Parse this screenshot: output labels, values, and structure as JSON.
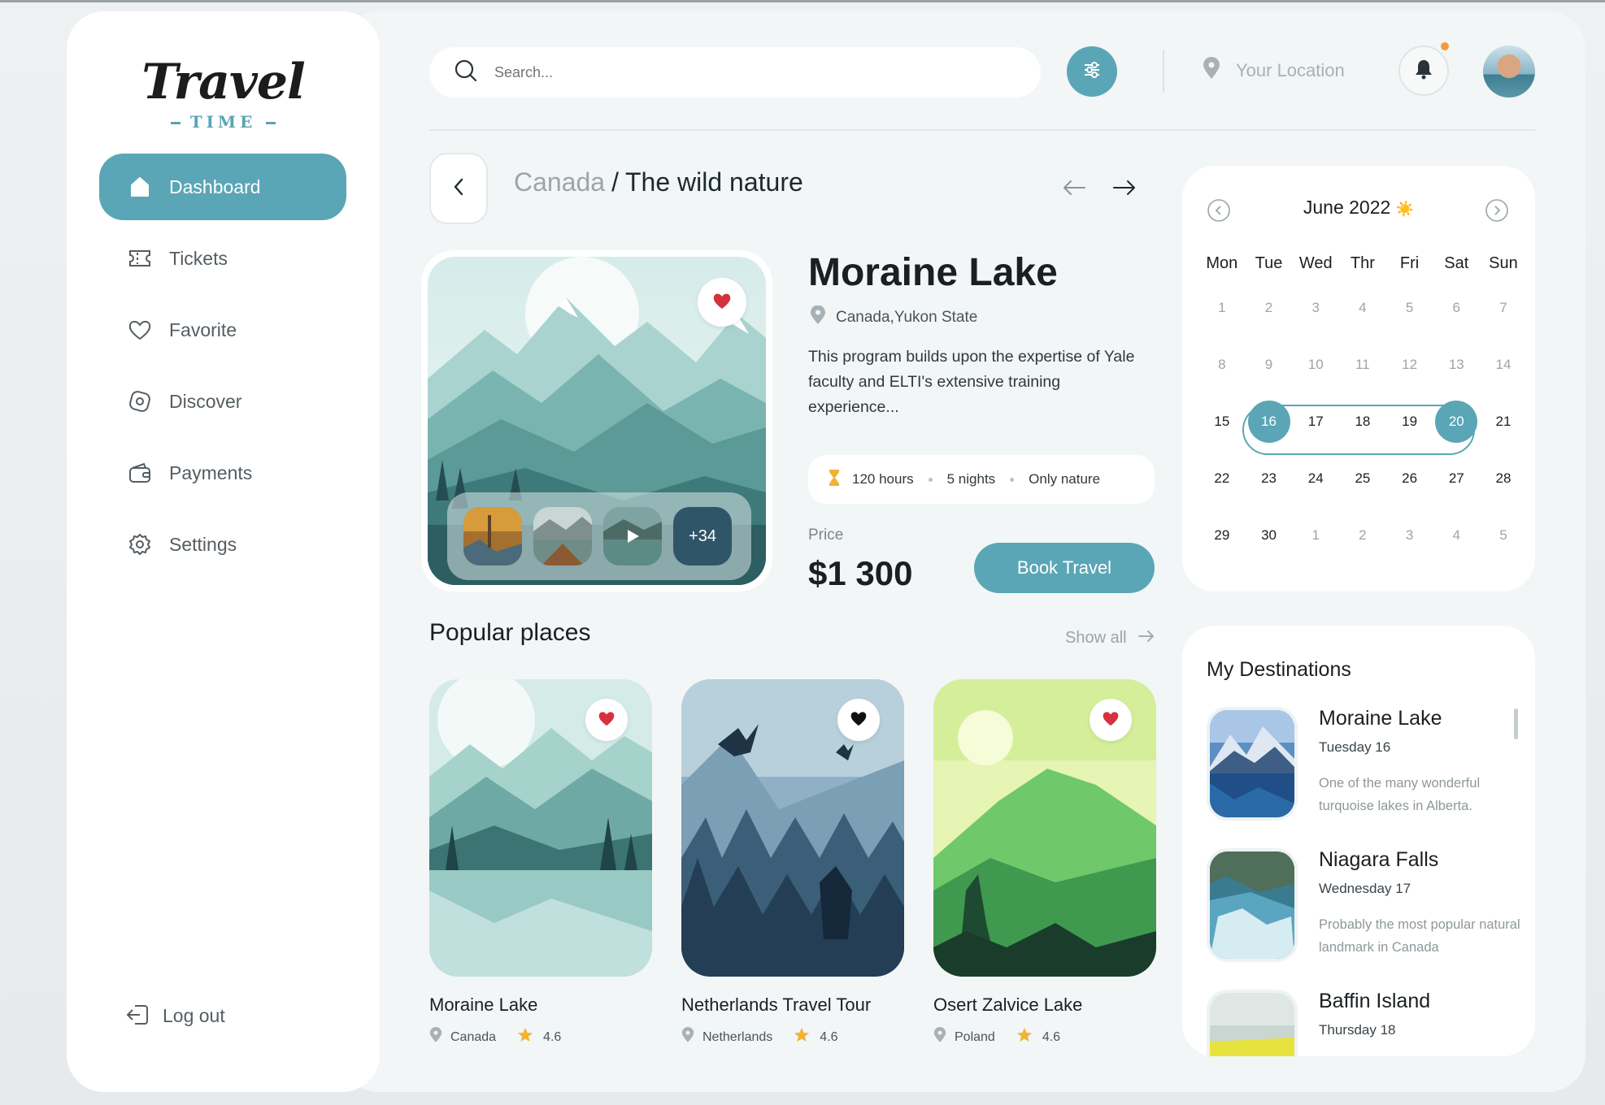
{
  "app": {
    "logo_main": "Travel",
    "logo_sub": "TIME"
  },
  "sidebar": {
    "items": [
      {
        "label": "Dashboard",
        "icon": "home-icon",
        "active": true
      },
      {
        "label": "Tickets",
        "icon": "ticket-icon",
        "active": false
      },
      {
        "label": "Favorite",
        "icon": "heart-icon",
        "active": false
      },
      {
        "label": "Discover",
        "icon": "compass-icon",
        "active": false
      },
      {
        "label": "Payments",
        "icon": "wallet-icon",
        "active": false
      },
      {
        "label": "Settings",
        "icon": "gear-icon",
        "active": false
      }
    ],
    "logout_label": "Log out"
  },
  "header": {
    "search_placeholder": "Search...",
    "location_placeholder": "Your Location",
    "has_notification": true
  },
  "breadcrumb": {
    "parent": "Canada",
    "separator": "/",
    "current": "The wild nature"
  },
  "featured": {
    "title": "Moraine Lake",
    "location": "Canada,Yukon State",
    "description": "This program builds upon the expertise of Yale faculty and ELTI's extensive training experience...",
    "meta": [
      "120 hours",
      "5 nights",
      "Only nature"
    ],
    "price_label": "Price",
    "price": "$1 300",
    "book_label": "Book Travel",
    "more_photos": "+34",
    "favorited": true
  },
  "calendar": {
    "title": "June 2022",
    "title_emoji": "☀️",
    "weekdays": [
      "Mon",
      "Tue",
      "Wed",
      "Thr",
      "Fri",
      "Sat",
      "Sun"
    ],
    "weeks": [
      [
        "1",
        "2",
        "3",
        "4",
        "5",
        "6",
        "7"
      ],
      [
        "8",
        "9",
        "10",
        "11",
        "12",
        "13",
        "14"
      ],
      [
        "15",
        "16",
        "17",
        "18",
        "19",
        "20",
        "21"
      ],
      [
        "22",
        "23",
        "24",
        "25",
        "26",
        "27",
        "28"
      ],
      [
        "29",
        "30",
        "1",
        "2",
        "3",
        "4",
        "5"
      ]
    ],
    "range_start": "16",
    "range_end": "20"
  },
  "popular": {
    "title": "Popular places",
    "show_all": "Show all",
    "cards": [
      {
        "name": "Moraine Lake",
        "country": "Canada",
        "rating": "4.6",
        "heart_color": "#d6313f"
      },
      {
        "name": "Netherlands Travel Tour",
        "country": "Netherlands",
        "rating": "4.6",
        "heart_color": "#111111"
      },
      {
        "name": "Osert Zalvice Lake",
        "country": "Poland",
        "rating": "4.6",
        "heart_color": "#d6313f"
      }
    ]
  },
  "destinations": {
    "title": "My Destinations",
    "items": [
      {
        "name": "Moraine Lake",
        "day": "Tuesday 16",
        "desc": "One of the many wonderful turquoise lakes in Alberta."
      },
      {
        "name": "Niagara Falls",
        "day": "Wednesday 17",
        "desc": "Probably the most popular natural landmark in Canada"
      },
      {
        "name": "Baffin Island",
        "day": "Thursday 18",
        "desc": ""
      }
    ]
  },
  "colors": {
    "accent": "#5aa6b6",
    "heart": "#d6313f",
    "star": "#f2b233",
    "notify": "#f29b3e"
  }
}
